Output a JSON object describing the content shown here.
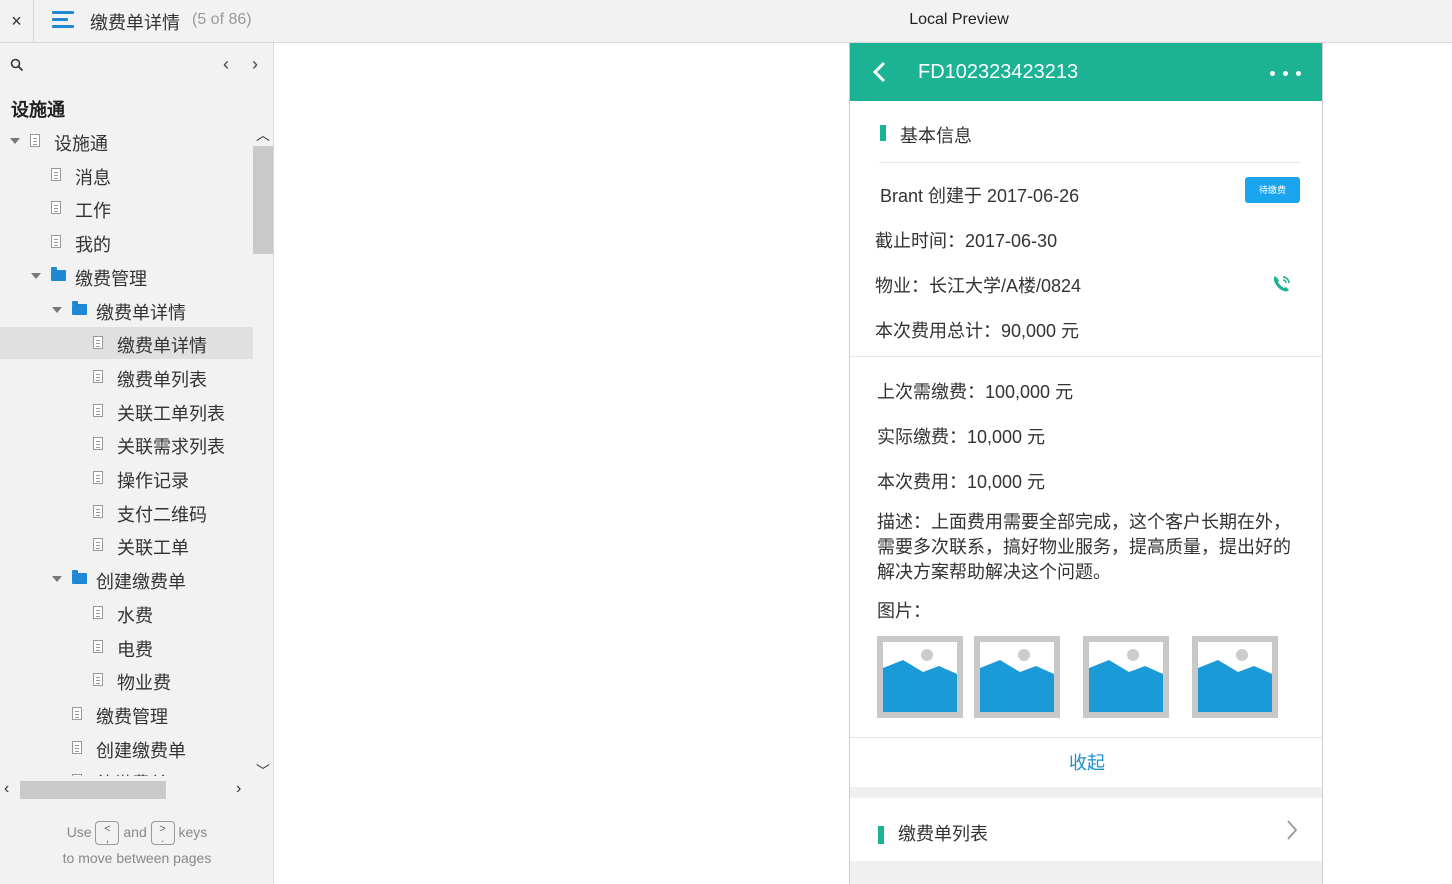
{
  "topbar": {
    "close_label": "×",
    "page_title": "缴费单详情",
    "page_count": "(5 of 86)",
    "preview_title": "Local Preview"
  },
  "sidebar": {
    "project_title": "设施通",
    "prev_label": "‹",
    "next_label": "›",
    "tree": [
      {
        "label": "设施通",
        "type": "page",
        "expanded": true
      },
      {
        "label": "消息",
        "type": "page"
      },
      {
        "label": "工作",
        "type": "page"
      },
      {
        "label": "我的",
        "type": "page"
      },
      {
        "label": "缴费管理",
        "type": "folder",
        "expanded": true
      },
      {
        "label": "缴费单详情",
        "type": "folder",
        "expanded": true
      },
      {
        "label": "缴费单详情",
        "type": "page",
        "selected": true
      },
      {
        "label": "缴费单列表",
        "type": "page"
      },
      {
        "label": "关联工单列表",
        "type": "page"
      },
      {
        "label": "关联需求列表",
        "type": "page"
      },
      {
        "label": "操作记录",
        "type": "page"
      },
      {
        "label": "支付二维码",
        "type": "page"
      },
      {
        "label": "关联工单",
        "type": "page"
      },
      {
        "label": "创建缴费单",
        "type": "folder",
        "expanded": true
      },
      {
        "label": "水费",
        "type": "page"
      },
      {
        "label": "电费",
        "type": "page"
      },
      {
        "label": "物业费",
        "type": "page"
      },
      {
        "label": "缴费管理",
        "type": "page"
      },
      {
        "label": "创建缴费单",
        "type": "page"
      },
      {
        "label": "待缴费单",
        "type": "page"
      }
    ],
    "hint": {
      "use": "Use",
      "key_prev": "<\n,",
      "and": "and",
      "key_next": ">\n.",
      "keys": "keys",
      "line2": "to move between pages"
    }
  },
  "phone": {
    "order_no": "FD102323423213",
    "basic_section_title": "基本信息",
    "creator_line": "Brant 创建于 2017-06-26",
    "status_badge": "待缴费",
    "deadline": "截止时间：2017-06-30",
    "property": "物业：长江大学/A楼/0824",
    "total": "本次费用总计：90,000 元",
    "last_due": "上次需缴费：100,000 元",
    "actual_paid": "实际缴费：10,000 元",
    "this_fee": "本次费用：10,000 元",
    "description": "描述：上面费用需要全部完成，这个客户长期在外，需要多次联系，搞好物业服务，提高质量，提出好的解决方案帮助解决这个问题。",
    "images_label": "图片：",
    "collapse_label": "收起",
    "list_section_title": "缴费单列表"
  },
  "colors": {
    "accent_green": "#1bb394",
    "link_blue": "#1a8fcf",
    "badge_blue": "#1aa5ee",
    "folder_blue": "#1e88d4"
  }
}
